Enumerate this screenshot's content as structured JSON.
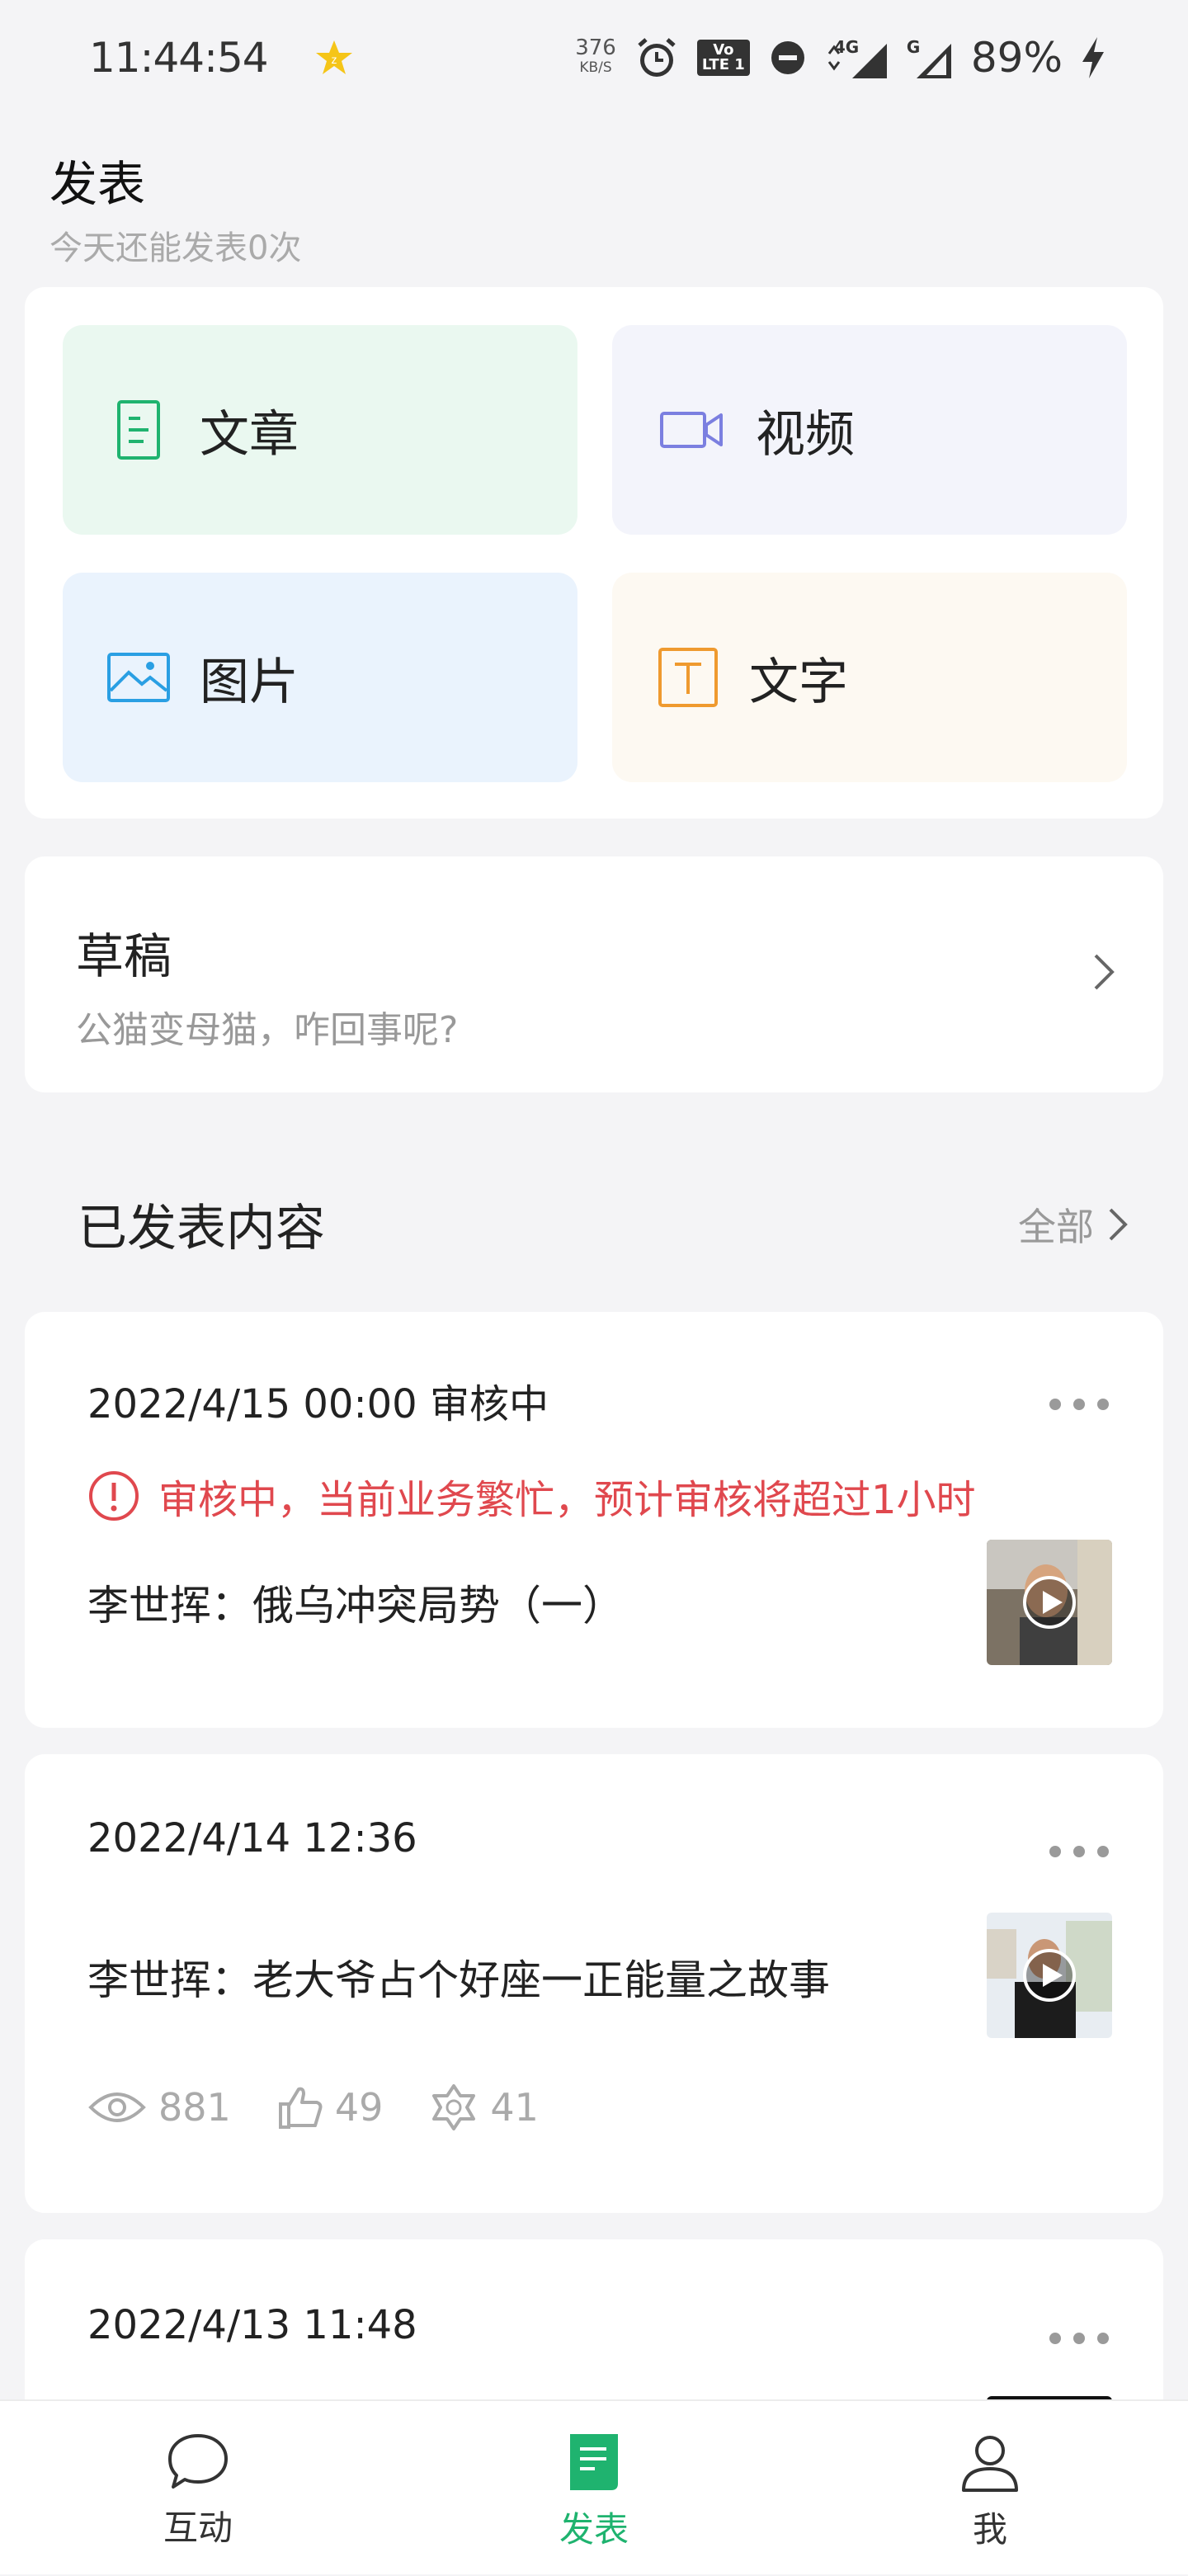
{
  "status_bar": {
    "time": "11:44:54",
    "net_speed_value": "376",
    "net_speed_unit": "KB/S",
    "lte_badge": "Vo LTE 1",
    "network_4g": "4G",
    "network_g": "G",
    "battery": "89%"
  },
  "header": {
    "title": "发表",
    "subtitle": "今天还能发表0次"
  },
  "publish_types": [
    {
      "label": "文章",
      "icon": "article-icon",
      "color": "#1fb36f"
    },
    {
      "label": "视频",
      "icon": "video-camera-icon",
      "color": "#7b7fe0"
    },
    {
      "label": "图片",
      "icon": "image-icon",
      "color": "#2a9fe3"
    },
    {
      "label": "文字",
      "icon": "text-t-icon",
      "color": "#ef9a2f"
    }
  ],
  "drafts": {
    "title": "草稿",
    "preview": "公猫变母猫，咋回事呢?"
  },
  "published": {
    "title": "已发表内容",
    "all_label": "全部",
    "posts": [
      {
        "date": "2022/4/15 00:00 审核中",
        "warning": "审核中，当前业务繁忙，预计审核将超过1小时",
        "title": "李世挥：俄乌冲突局势（一）"
      },
      {
        "date": "2022/4/14 12:36",
        "title": "李世挥：老大爷占个好座一正能量之故事",
        "views": "881",
        "likes": "49",
        "shares": "41"
      },
      {
        "date": "2022/4/13 11:48"
      }
    ]
  },
  "bottom_nav": {
    "items": [
      {
        "label": "互动",
        "icon": "chat-bubble-icon"
      },
      {
        "label": "发表",
        "icon": "document-icon"
      },
      {
        "label": "我",
        "icon": "user-icon"
      }
    ],
    "active_index": 1
  },
  "colors": {
    "accent_green": "#1fb36f",
    "warning_red": "#e0484e",
    "background": "#f4f4f6"
  }
}
